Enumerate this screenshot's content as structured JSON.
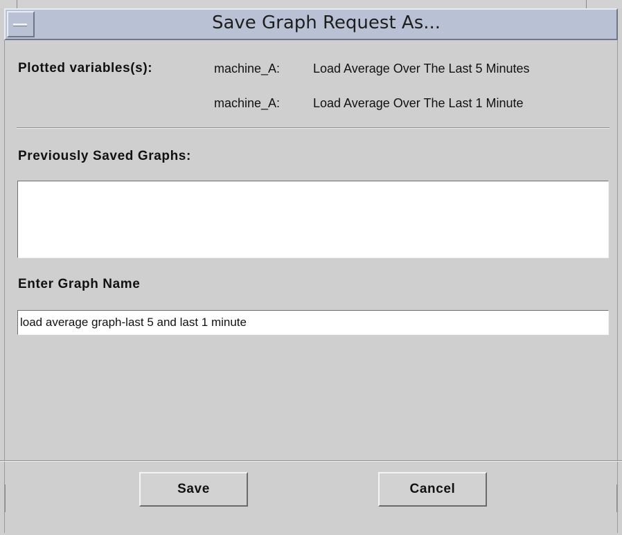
{
  "window": {
    "title": "Save Graph Request As..."
  },
  "plotted": {
    "label": "Plotted variables(s):",
    "rows": [
      {
        "host": "machine_A:",
        "metric": "Load Average Over The Last 5 Minutes"
      },
      {
        "host": "machine_A:",
        "metric": "Load Average Over The Last 1 Minute"
      }
    ]
  },
  "saved_graphs": {
    "label": "Previously Saved Graphs:",
    "items": []
  },
  "graph_name": {
    "label": "Enter Graph Name",
    "value": "load average graph-last 5 and last 1 minute"
  },
  "buttons": {
    "save_label": "Save",
    "cancel_label": "Cancel"
  },
  "colors": {
    "titlebar": "#b9c2d4",
    "dialog_background": "#cfcfcf",
    "field_background": "#ffffff"
  }
}
